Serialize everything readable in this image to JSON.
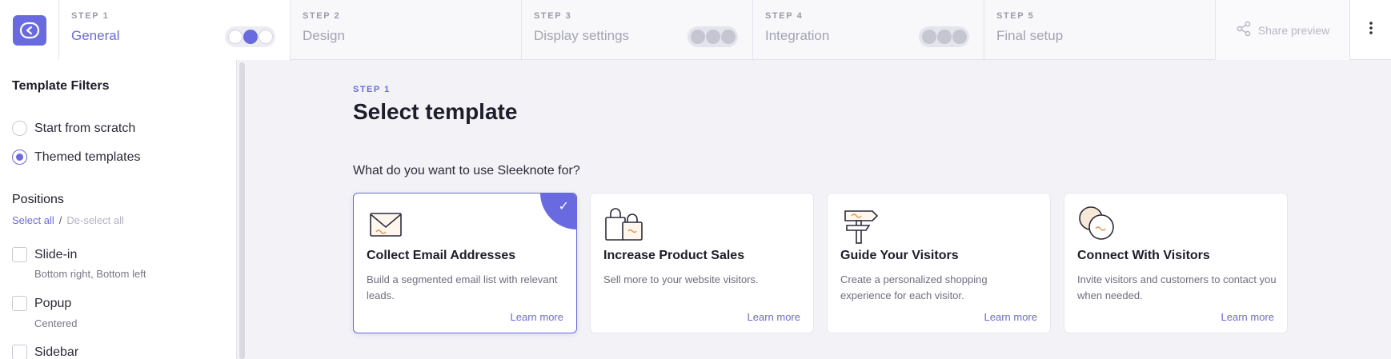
{
  "steps": [
    {
      "num": "STEP 1",
      "title": "General"
    },
    {
      "num": "STEP 2",
      "title": "Design"
    },
    {
      "num": "STEP 3",
      "title": "Display settings"
    },
    {
      "num": "STEP 4",
      "title": "Integration"
    },
    {
      "num": "STEP 5",
      "title": "Final setup"
    }
  ],
  "header": {
    "share_label": "Share preview",
    "accent": "#6a6ae0"
  },
  "sidebar": {
    "title": "Template Filters",
    "modes": [
      {
        "label": "Start from scratch",
        "checked": false
      },
      {
        "label": "Themed templates",
        "checked": true
      }
    ],
    "positions_title": "Positions",
    "select_all": "Select all",
    "separator": "/",
    "deselect_all": "De-select all",
    "positions": [
      {
        "label": "Slide-in",
        "sub": "Bottom right, Bottom left"
      },
      {
        "label": "Popup",
        "sub": "Centered"
      },
      {
        "label": "Sidebar",
        "sub": ""
      }
    ]
  },
  "main": {
    "step_label": "STEP 1",
    "title": "Select template",
    "question": "What do you want to use Sleeknote for?",
    "cards": [
      {
        "title": "Collect Email Addresses",
        "desc": "Build a segmented email list with relevant leads.",
        "link": "Learn more",
        "icon": "envelope-icon",
        "selected": true
      },
      {
        "title": "Increase Product Sales",
        "desc": "Sell more to your website visitors.",
        "link": "Learn more",
        "icon": "shopping-bags-icon",
        "selected": false
      },
      {
        "title": "Guide Your Visitors",
        "desc": "Create a personalized shopping experience for each visitor.",
        "link": "Learn more",
        "icon": "signpost-icon",
        "selected": false
      },
      {
        "title": "Connect With Visitors",
        "desc": "Invite visitors and customers to contact you when needed.",
        "link": "Learn more",
        "icon": "chat-bubbles-icon",
        "selected": false
      }
    ],
    "check_mark": "✓"
  }
}
